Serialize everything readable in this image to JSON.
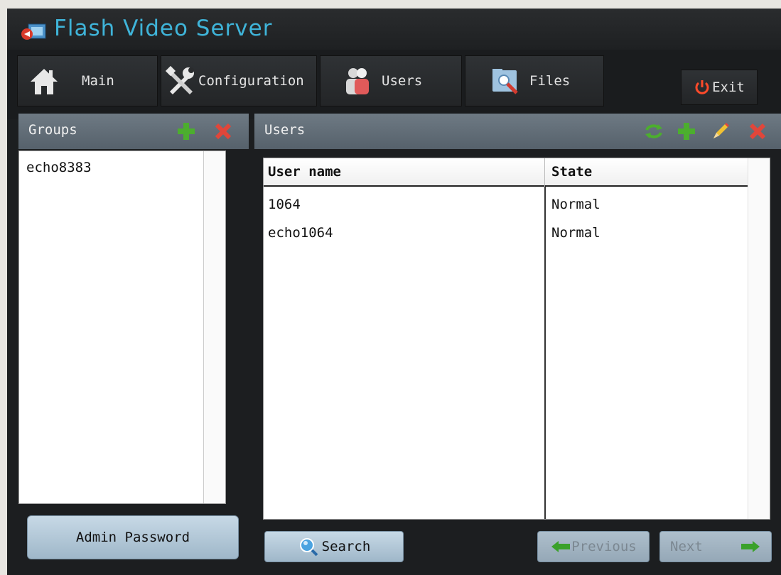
{
  "app": {
    "title": "Flash Video Server"
  },
  "nav": {
    "main_label": "Main",
    "configuration_label": "Configuration",
    "users_label": "Users",
    "files_label": "Files",
    "exit_label": "Exit"
  },
  "groups_panel": {
    "title": "Groups",
    "items": [
      "echo8383"
    ],
    "admin_password_label": "Admin Password"
  },
  "users_panel": {
    "title": "Users",
    "columns": [
      "User name",
      "State"
    ],
    "rows": [
      {
        "user_name": "1064",
        "state": "Normal"
      },
      {
        "user_name": "echo1064",
        "state": "Normal"
      }
    ],
    "search_label": "Search",
    "previous_label": "Previous",
    "next_label": "Next"
  },
  "colors": {
    "title_blue": "#3fb4d9",
    "add_green": "#4cae2e",
    "delete_red": "#e0463a",
    "edit_yellow": "#f1c232",
    "panel_header": "#5f6b75"
  }
}
